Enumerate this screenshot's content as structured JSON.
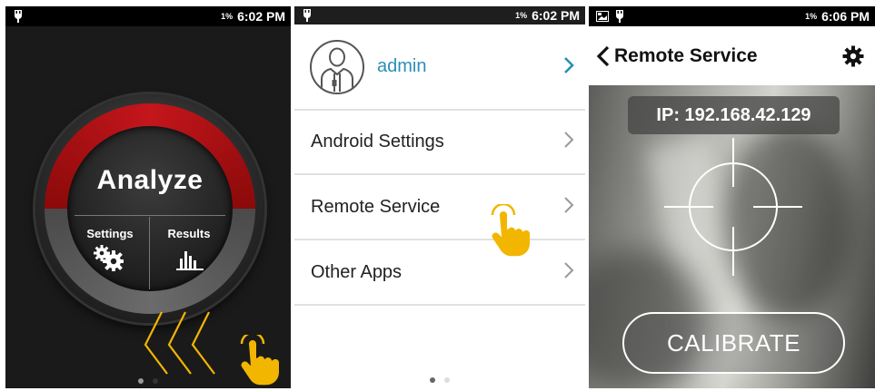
{
  "colors": {
    "accent_yellow": "#f2b600",
    "link_blue": "#2a8fb5",
    "dial_red": "#c4161c"
  },
  "panel1": {
    "status": {
      "battery_pct": "1%",
      "time": "6:02 PM",
      "icon": "usb-debug-icon"
    },
    "dial": {
      "title": "Analyze",
      "settings_label": "Settings",
      "results_label": "Results"
    },
    "page_indicator": {
      "current": 1,
      "total": 2
    },
    "gesture": "swipe-left"
  },
  "panel2": {
    "status": {
      "battery_pct": "1%",
      "time": "6:02 PM",
      "icon": "usb-debug-icon"
    },
    "user": {
      "name": "admin",
      "icon": "user-avatar-icon"
    },
    "menu": [
      {
        "label": "Android Settings"
      },
      {
        "label": "Remote Service"
      },
      {
        "label": "Other Apps"
      }
    ],
    "page_indicator": {
      "current": 1,
      "total": 2
    },
    "gesture": "tap"
  },
  "panel3": {
    "status": {
      "battery_pct": "1%",
      "time": "6:06 PM",
      "icons": [
        "image-icon",
        "usb-debug-icon"
      ]
    },
    "appbar": {
      "title": "Remote Service",
      "back_icon": "chevron-left-icon",
      "settings_icon": "gear-icon"
    },
    "ip_label": "IP: 192.168.42.129",
    "calibrate_label": "CALIBRATE"
  }
}
